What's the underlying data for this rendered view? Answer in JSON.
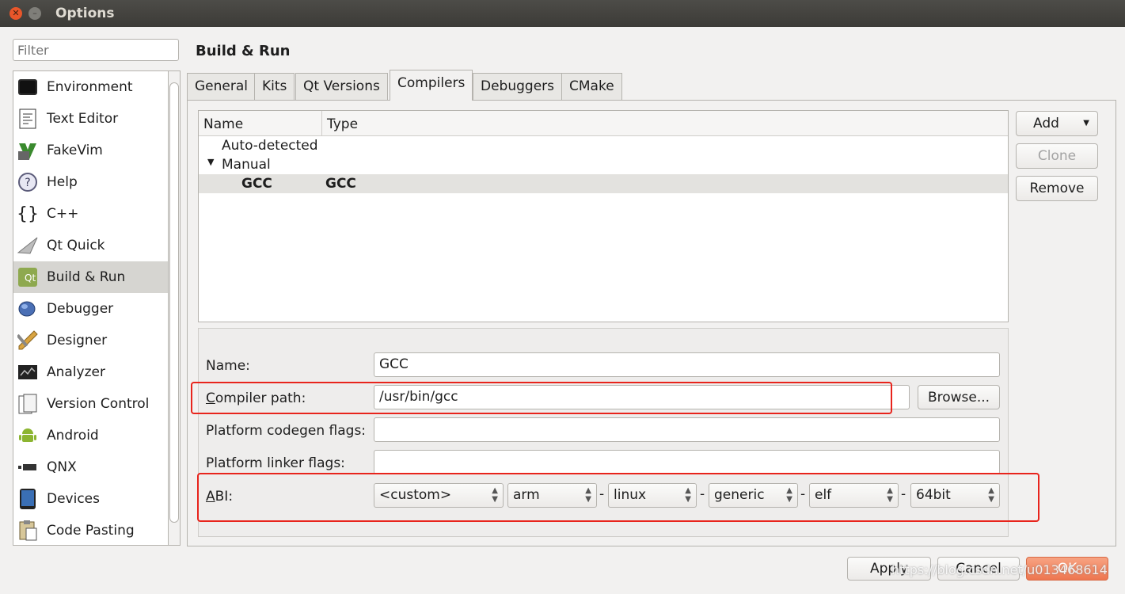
{
  "window": {
    "title": "Options"
  },
  "filter": {
    "placeholder": "Filter"
  },
  "categories": [
    {
      "label": "Environment",
      "icon": "monitor-icon"
    },
    {
      "label": "Text Editor",
      "icon": "text-document-icon"
    },
    {
      "label": "FakeVim",
      "icon": "fakevim-icon"
    },
    {
      "label": "Help",
      "icon": "help-icon"
    },
    {
      "label": "C++",
      "icon": "braces-icon"
    },
    {
      "label": "Qt Quick",
      "icon": "paper-plane-icon"
    },
    {
      "label": "Build & Run",
      "icon": "qt-build-icon"
    },
    {
      "label": "Debugger",
      "icon": "bug-icon"
    },
    {
      "label": "Designer",
      "icon": "brush-ruler-icon"
    },
    {
      "label": "Analyzer",
      "icon": "chart-monitor-icon"
    },
    {
      "label": "Version Control",
      "icon": "folder-document-icon"
    },
    {
      "label": "Android",
      "icon": "android-icon"
    },
    {
      "label": "QNX",
      "icon": "qnx-logo-icon"
    },
    {
      "label": "Devices",
      "icon": "tablet-icon"
    },
    {
      "label": "Code Pasting",
      "icon": "clipboard-icon"
    }
  ],
  "selected_category": "Build & Run",
  "page_title": "Build & Run",
  "tabs": [
    "General",
    "Kits",
    "Qt Versions",
    "Compilers",
    "Debuggers",
    "CMake"
  ],
  "active_tab": "Compilers",
  "tree": {
    "columns": [
      "Name",
      "Type"
    ],
    "groups": [
      "Auto-detected",
      "Manual"
    ],
    "rows": [
      {
        "name": "GCC",
        "type": "GCC"
      }
    ]
  },
  "side_buttons": {
    "add": "Add",
    "clone": "Clone",
    "remove": "Remove"
  },
  "form": {
    "name_label": "Name:",
    "name_value": "GCC",
    "compiler_path_label_first": "C",
    "compiler_path_label_rest": "ompiler path:",
    "compiler_path_value": "/usr/bin/gcc",
    "browse": "Browse...",
    "codegen_label": "Platform codegen flags:",
    "codegen_value": "",
    "linker_label": "Platform linker flags:",
    "linker_value": "",
    "abi_label_first": "A",
    "abi_label_rest": "BI:",
    "abi": [
      "<custom>",
      "arm",
      "linux",
      "generic",
      "elf",
      "64bit"
    ],
    "abi_separator": "-"
  },
  "footer": {
    "apply": "Apply",
    "cancel": "Cancel",
    "ok": "OK"
  },
  "watermark": "https://blog.csdn.net/u013468614",
  "colors": {
    "highlight": "#e8241c",
    "ok_button": "#ee7650",
    "titlebar": "#3c3b37",
    "close_button": "#e8562a"
  }
}
